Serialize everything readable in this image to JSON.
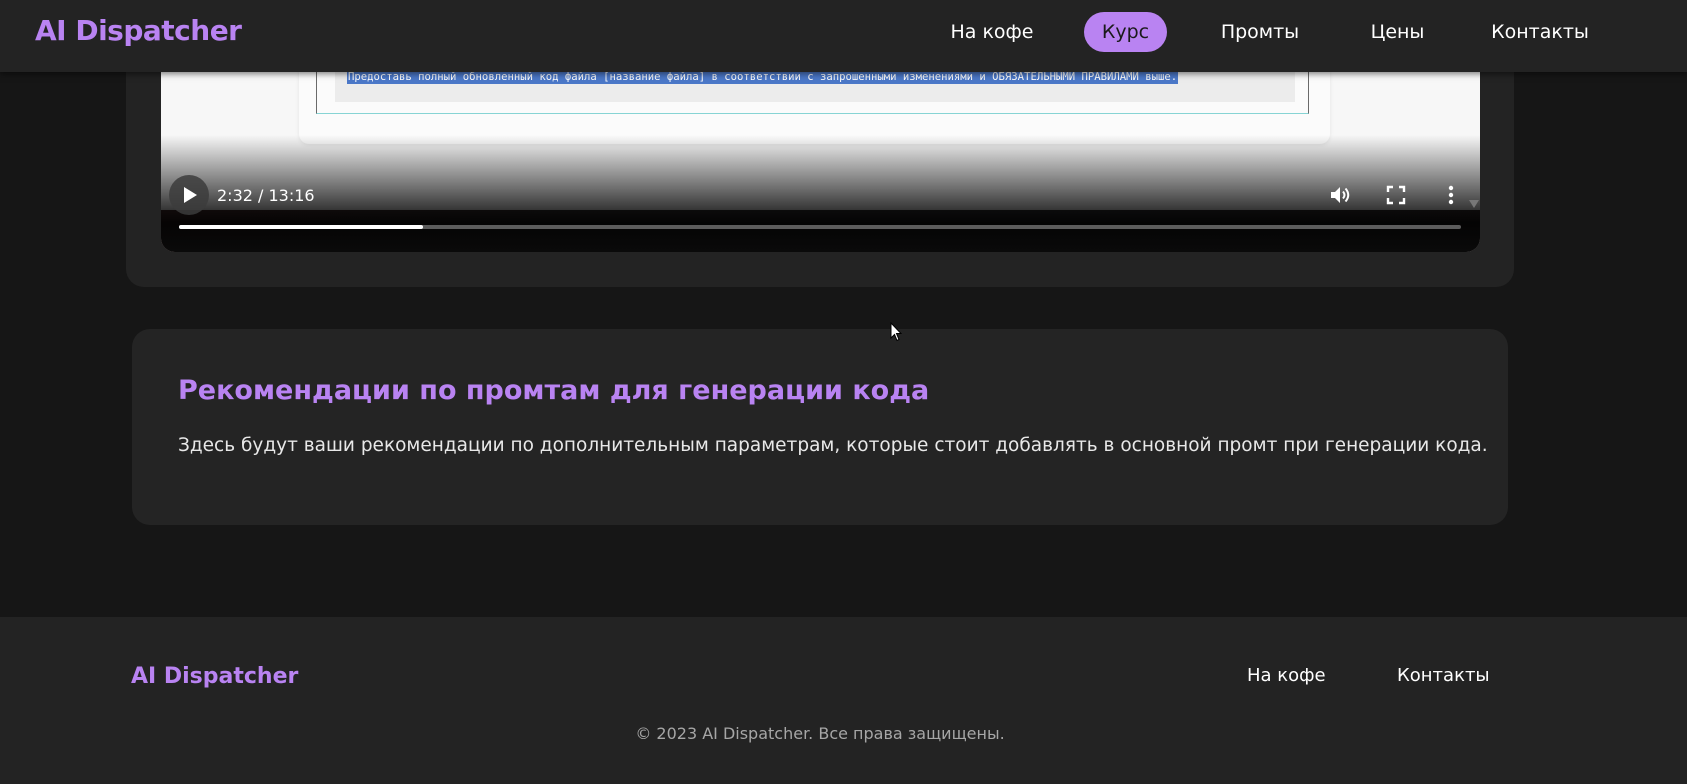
{
  "header": {
    "logo": "AI Dispatcher",
    "nav": [
      {
        "label": "На кофе",
        "active": false
      },
      {
        "label": "Курс",
        "active": true
      },
      {
        "label": "Промты",
        "active": false
      },
      {
        "label": "Цены",
        "active": false
      },
      {
        "label": "Контакты",
        "active": false
      }
    ]
  },
  "video": {
    "code_line": "Предоставь полный обновленный код файла [название файла] в соответствии с запрошенными изменениями и ОБЯЗАТЕЛЬНЫМИ ПРАВИЛАМИ выше.",
    "time_display": "2:32 / 13:16",
    "progress_fraction": 0.19,
    "icons": [
      "play-icon",
      "volume-icon",
      "fullscreen-icon",
      "more-options-icon"
    ]
  },
  "recommendations": {
    "title": "Рекомендации по промтам для генерации кода",
    "text": "Здесь будут ваши рекомендации по дополнительным параметрам, которые стоит добавлять в основной промт при генерации кода."
  },
  "footer": {
    "logo": "AI Dispatcher",
    "links": [
      "На кофе",
      "Контакты"
    ],
    "copyright": "© 2023 AI Dispatcher. Все права защищены."
  },
  "colors": {
    "accent": "#b983f2",
    "background": "#161616",
    "surface": "#232323"
  }
}
